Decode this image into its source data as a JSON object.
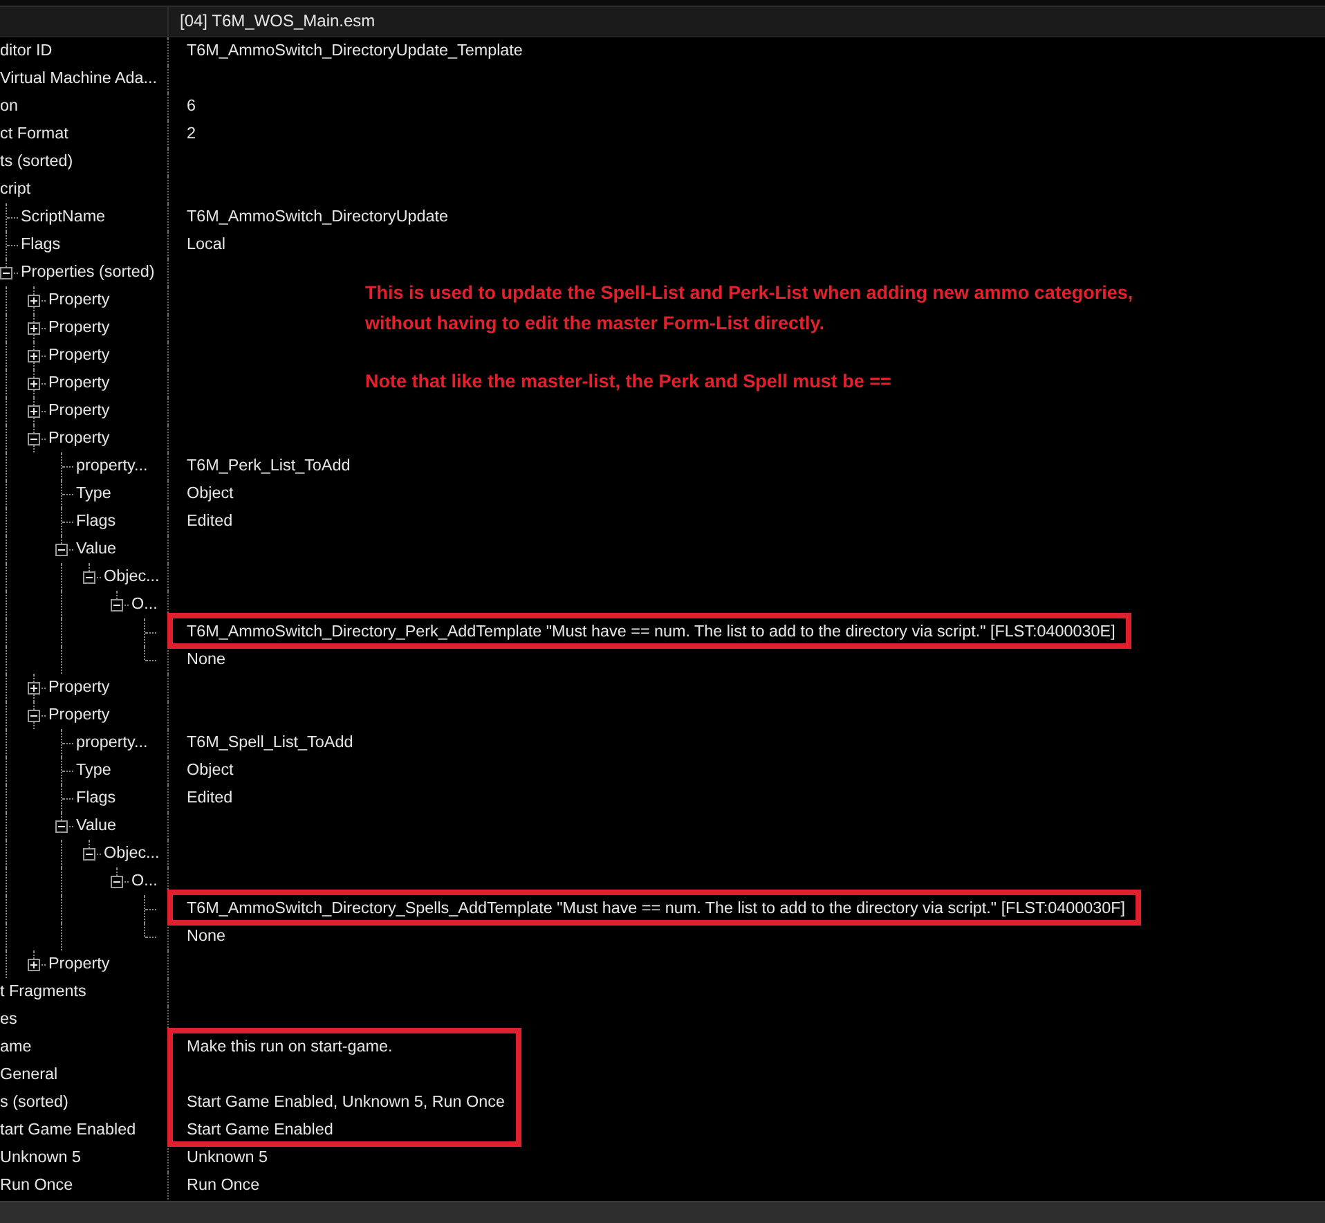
{
  "header": {
    "file": "[04] T6M_WOS_Main.esm"
  },
  "tree": [
    {
      "label": "ditor ID",
      "value": "T6M_AmmoSwitch_DirectoryUpdate_Template",
      "highlighted": false
    },
    {
      "label": "Virtual Machine Ada...",
      "highlighted": false
    },
    {
      "label": "on",
      "value": "6",
      "highlighted": false
    },
    {
      "label": "ct Format",
      "value": "2",
      "highlighted": false
    },
    {
      "label": "ts (sorted)",
      "highlighted": false
    },
    {
      "label": "cript",
      "highlighted": false,
      "children": [
        {
          "label": "ScriptName",
          "value": "T6M_AmmoSwitch_DirectoryUpdate",
          "highlighted": false
        },
        {
          "label": "Flags",
          "value": "Local",
          "highlighted": false
        },
        {
          "label": "Properties (sorted)",
          "expanded": true,
          "highlighted": false,
          "children": [
            {
              "label": "Property",
              "expanded": false,
              "highlighted": false
            },
            {
              "label": "Property",
              "expanded": false,
              "highlighted": false
            },
            {
              "label": "Property",
              "expanded": false,
              "highlighted": false
            },
            {
              "label": "Property",
              "expanded": false,
              "highlighted": false
            },
            {
              "label": "Property",
              "expanded": false,
              "highlighted": false
            },
            {
              "label": "Property",
              "expanded": true,
              "highlighted": false,
              "children": [
                {
                  "label": "property...",
                  "value": "T6M_Perk_List_ToAdd",
                  "highlighted": false
                },
                {
                  "label": "Type",
                  "value": "Object",
                  "highlighted": false
                },
                {
                  "label": "Flags",
                  "value": "Edited",
                  "highlighted": false
                },
                {
                  "label": "Value",
                  "expanded": true,
                  "highlighted": false,
                  "children": [
                    {
                      "label": "Objec...",
                      "expanded": true,
                      "highlighted": false,
                      "children": [
                        {
                          "label": "O...",
                          "expanded": true,
                          "highlighted": false,
                          "children": [
                            {
                              "value": "T6M_AmmoSwitch_Directory_Perk_AddTemplate \"Must have == num. The list to add to the directory via script.\" [FLST:0400030E]",
                              "highlighted": true
                            },
                            {
                              "value": "None",
                              "highlighted": false
                            }
                          ]
                        }
                      ]
                    }
                  ]
                }
              ]
            },
            {
              "label": "Property",
              "expanded": false,
              "highlighted": false
            },
            {
              "label": "Property",
              "expanded": true,
              "highlighted": false,
              "children": [
                {
                  "label": "property...",
                  "value": "T6M_Spell_List_ToAdd",
                  "highlighted": false
                },
                {
                  "label": "Type",
                  "value": "Object",
                  "highlighted": false
                },
                {
                  "label": "Flags",
                  "value": "Edited",
                  "highlighted": false
                },
                {
                  "label": "Value",
                  "expanded": true,
                  "highlighted": false,
                  "children": [
                    {
                      "label": "Objec...",
                      "expanded": true,
                      "highlighted": false,
                      "children": [
                        {
                          "label": "O...",
                          "expanded": true,
                          "highlighted": false,
                          "children": [
                            {
                              "value": "T6M_AmmoSwitch_Directory_Spells_AddTemplate \"Must have == num. The list to add to the directory via script.\" [FLST:0400030F]",
                              "highlighted": true
                            },
                            {
                              "value": "None",
                              "highlighted": false
                            }
                          ]
                        }
                      ]
                    }
                  ]
                }
              ]
            },
            {
              "label": "Property",
              "expanded": false,
              "highlighted": false
            }
          ]
        }
      ]
    },
    {
      "label": "t Fragments",
      "highlighted": false
    },
    {
      "label": "es",
      "highlighted": false
    },
    {
      "label": "ame",
      "value": "Make this run on start-game.",
      "highlighted": true
    },
    {
      "label": "General",
      "highlighted": true
    },
    {
      "label": "s (sorted)",
      "value": "Start Game Enabled, Unknown 5, Run Once",
      "highlighted": true
    },
    {
      "label": "tart Game Enabled",
      "value": "Start Game Enabled",
      "highlighted": true
    },
    {
      "label": "Unknown 5",
      "value": "Unknown 5",
      "highlighted": false
    },
    {
      "label": "Run Once",
      "value": "Run Once",
      "highlighted": false
    }
  ],
  "note": [
    "This is used to update the Spell-List and Perk-List when adding new ammo categories, without having to edit the master Form-List directly.",
    "Note that like the master-list, the Perk and Spell must be =="
  ]
}
